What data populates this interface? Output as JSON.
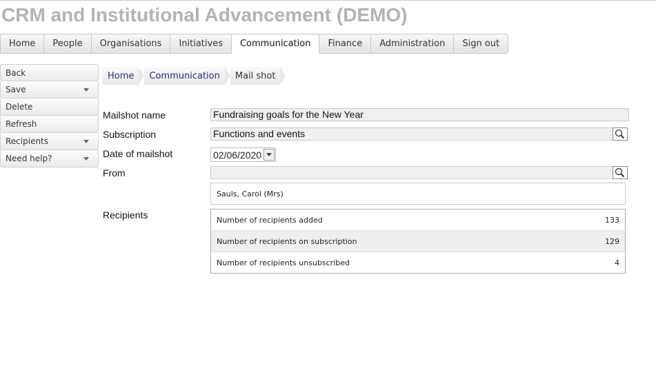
{
  "app": {
    "title": "CRM and Institutional Advancement (DEMO)"
  },
  "nav": {
    "tabs": [
      {
        "label": "Home"
      },
      {
        "label": "People"
      },
      {
        "label": "Organisations"
      },
      {
        "label": "Initiatives"
      },
      {
        "label": "Communication",
        "active": true
      },
      {
        "label": "Finance"
      },
      {
        "label": "Administration"
      },
      {
        "label": "Sign out"
      }
    ]
  },
  "sidebar": {
    "items": [
      {
        "label": "Back"
      },
      {
        "label": "Save",
        "has_dropdown": true
      },
      {
        "label": "Delete"
      },
      {
        "label": "Refresh"
      },
      {
        "label": "Recipients",
        "has_dropdown": true
      },
      {
        "label": "Need help?",
        "has_dropdown": true
      }
    ]
  },
  "breadcrumb": [
    {
      "label": "Home"
    },
    {
      "label": "Communication"
    },
    {
      "label": "Mail shot"
    }
  ],
  "form": {
    "mailshot_name": {
      "label": "Mailshot name",
      "value": "Fundraising goals for the New Year"
    },
    "subscription": {
      "label": "Subscription",
      "value": "Functions and events",
      "icon": "search-icon"
    },
    "date": {
      "label": "Date of mailshot",
      "value": "02/06/2020"
    },
    "from": {
      "label": "From",
      "value": "",
      "icon": "search-icon",
      "selected": "Sauls, Carol (Mrs)"
    },
    "recipients": {
      "label": "Recipients",
      "rows": [
        {
          "label": "Number of recipients added",
          "value": "133"
        },
        {
          "label": "Number of recipients on subscription",
          "value": "129"
        },
        {
          "label": "Number of recipients unsubscribed",
          "value": "4"
        }
      ]
    }
  },
  "colors": {
    "title": "#b3b3b3",
    "breadcrumb_link": "#2a2a78",
    "field_bg": "#f0f0f0"
  }
}
